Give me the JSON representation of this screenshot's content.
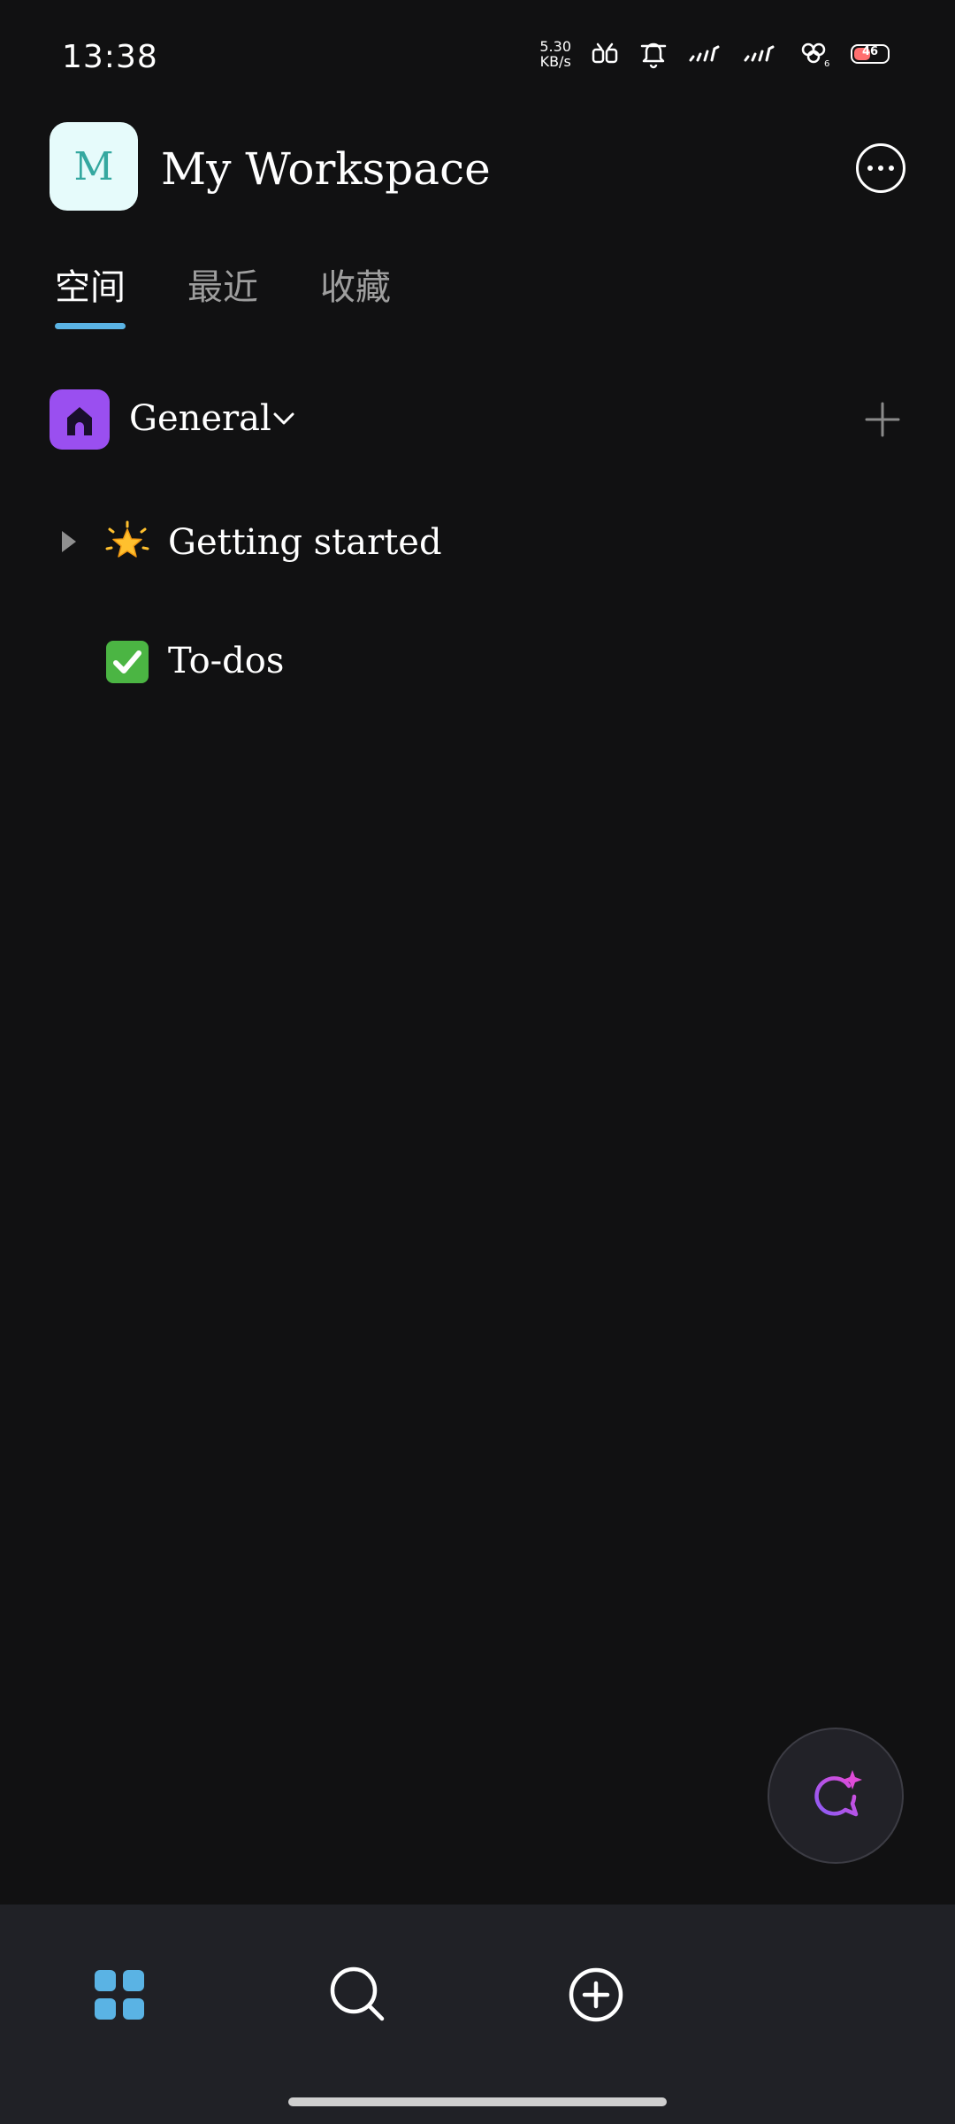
{
  "status_bar": {
    "time": "13:38",
    "net_speed_value": "5.30",
    "net_speed_unit": "KB/s",
    "battery_level": "46"
  },
  "workspace": {
    "avatar_letter": "M",
    "name": "My Workspace"
  },
  "tabs": [
    {
      "label": "空间",
      "active": true
    },
    {
      "label": "最近",
      "active": false
    },
    {
      "label": "收藏",
      "active": false
    }
  ],
  "section": {
    "label": "General"
  },
  "pages": [
    {
      "emoji": "star-emoji",
      "label": "Getting started",
      "expandable": true
    },
    {
      "emoji": "check-mark-emoji",
      "label": "To-dos",
      "expandable": false
    }
  ],
  "colors": {
    "background": "#111112",
    "tab_active_underline": "#5ab3e4",
    "space_icon": "#9a4ff0",
    "nav_active": "#5ab3e4",
    "workspace_avatar_bg": "#e6fbfb"
  },
  "bottom_nav": [
    {
      "icon": "grid-icon",
      "active": true
    },
    {
      "icon": "search-icon",
      "active": false
    },
    {
      "icon": "add-circle-icon",
      "active": false
    }
  ]
}
